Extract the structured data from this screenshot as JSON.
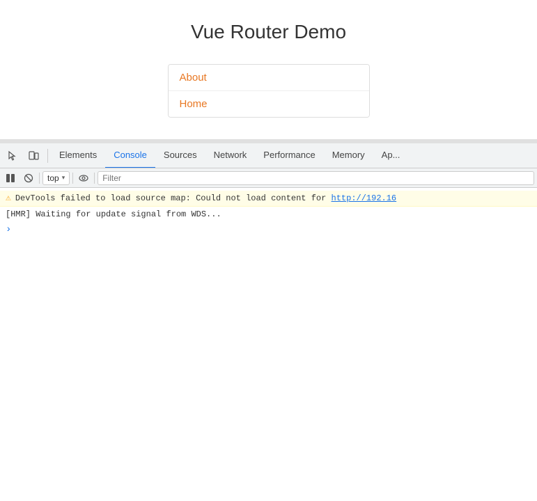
{
  "page": {
    "title": "Vue Router Demo",
    "nav": {
      "links": [
        {
          "label": "About",
          "href": "#/about",
          "color": "#e87722"
        },
        {
          "label": "Home",
          "href": "#/home",
          "color": "#e87722"
        }
      ]
    }
  },
  "devtools": {
    "tabs": [
      {
        "id": "elements",
        "label": "Elements",
        "active": false
      },
      {
        "id": "console",
        "label": "Console",
        "active": true
      },
      {
        "id": "sources",
        "label": "Sources",
        "active": false
      },
      {
        "id": "network",
        "label": "Network",
        "active": false
      },
      {
        "id": "performance",
        "label": "Performance",
        "active": false
      },
      {
        "id": "memory",
        "label": "Memory",
        "active": false
      },
      {
        "id": "application",
        "label": "Ap...",
        "active": false
      }
    ],
    "toolbar": {
      "top_label": "top",
      "filter_placeholder": "Filter"
    },
    "console_lines": [
      {
        "type": "warning",
        "icon": "⚠",
        "text_before_link": "DevTools failed to load source map: Could not load content for ",
        "link_text": "http://192.16",
        "link_href": "#"
      },
      {
        "type": "hmr",
        "text": "[HMR] Waiting for update signal from WDS..."
      }
    ]
  },
  "icons": {
    "inspect": "⬚",
    "device": "⊡",
    "cursor": "↖",
    "no_entry": "⊘",
    "eye": "👁",
    "chevron": "▾"
  }
}
